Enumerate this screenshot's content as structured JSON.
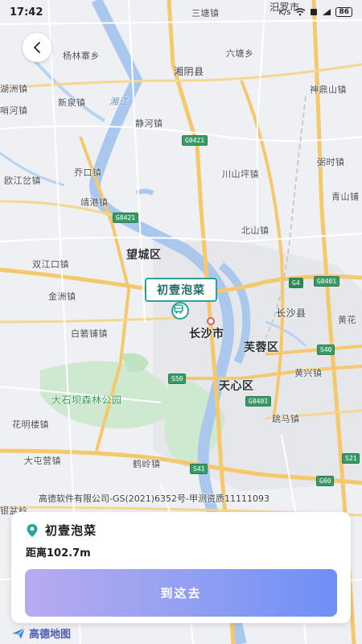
{
  "status_bar": {
    "time": "17:42",
    "network": "K/s",
    "battery": "86"
  },
  "map": {
    "labels": {
      "santang": "三塘镇",
      "miluo": "汨罗市",
      "liushi": "六塘乡",
      "xiangyin": "湘阴县",
      "yanglin": "杨林寨乡",
      "hu": "湖洲镇",
      "shending": "神鼎山镇",
      "xinquan": "新泉镇",
      "xiangjiang": "湘江",
      "shao": "哨河镇",
      "jinghe": "静河镇",
      "ruoshi": "弼时镇",
      "ouji": "欧江岔镇",
      "qiaokou": "乔口镇",
      "chuanshan": "川山坪镇",
      "qingshan": "青山铺",
      "jinggang": "靖港镇",
      "beishan": "北山镇",
      "wangcheng": "望城区",
      "shuangjiang": "双江口镇",
      "jinzhou": "金洲镇",
      "changsha_county": "长沙县",
      "huang": "黄花",
      "baishuo": "白箬铺镇",
      "changsha_city": "长沙市",
      "furong": "芙蓉区",
      "huangxing": "黄兴镇",
      "tianxin": "天心区",
      "dashiba": "大石坝森林公园",
      "huaming": "花明楼镇",
      "tiaoma": "跳马镇",
      "datun": "大屯营镇",
      "heling": "鹤岭镇",
      "yinpen": "银盆岭"
    },
    "roads": {
      "g0421_a": "G0421",
      "g0421_b": "G0421",
      "g4": "G4",
      "g0401_a": "G0401",
      "s40": "S40",
      "s50": "S50",
      "g0401_b": "G0401",
      "s41": "S41",
      "g60": "G60",
      "s21": "S21"
    },
    "marker": {
      "name": "初壹泡菜"
    },
    "attribution": "高德软件有限公司-GS(2021)6352号-甲测资质11111093"
  },
  "card": {
    "title": "初壹泡菜",
    "distance": "距离102.7m",
    "go_button": "到这去"
  },
  "logo": {
    "text": "高德地图"
  },
  "colors": {
    "accent_teal": "#27a59a",
    "button_gradient_start": "#b8abf0",
    "button_gradient_end": "#6e8ff6",
    "highway": "#f5c86b",
    "river": "#aac8ee",
    "forest": "#bfe2c2"
  }
}
